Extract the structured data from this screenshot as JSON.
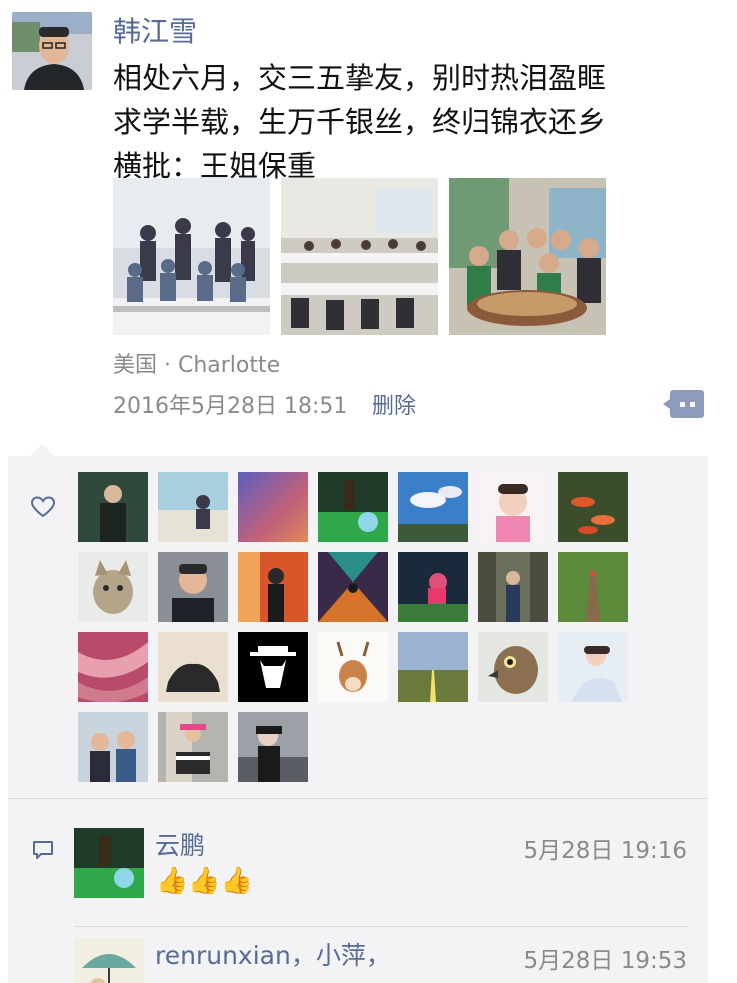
{
  "post": {
    "author": "韩江雪",
    "lines": [
      "相处六月，交三五挚友，别时热泪盈眶",
      "求学半载，生万千银丝，终归锦衣还乡",
      "横批：王姐保重"
    ],
    "location": "美国 · Charlotte",
    "timestamp": "2016年5月28日 18:51",
    "delete_label": "删除"
  },
  "likes": {
    "icon": "heart-icon",
    "count": 25
  },
  "comments": [
    {
      "author": "云鹏",
      "time": "5月28日 19:16",
      "body": "👍👍👍"
    },
    {
      "author": "renrunxian，小萍，",
      "time": "5月28日 19:53",
      "body": ""
    }
  ],
  "colors": {
    "link": "#576b95",
    "meta": "#8a8a8a",
    "panel_bg": "#f3f3f5",
    "more_button": "#8c9bb9"
  }
}
